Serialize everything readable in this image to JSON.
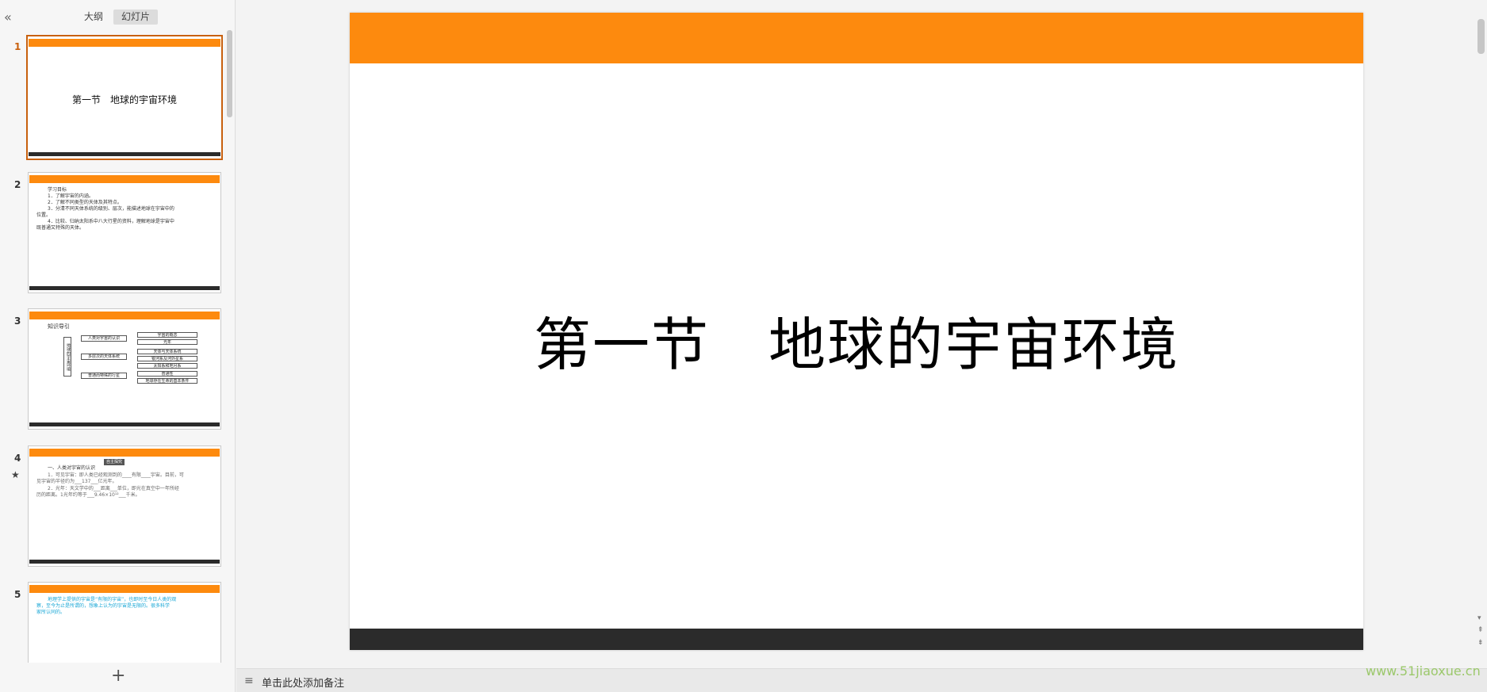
{
  "panel": {
    "collapse_icon": "«",
    "tabs": [
      "大纲",
      "幻灯片"
    ],
    "active_tab": "幻灯片"
  },
  "thumbnails": [
    {
      "num": "1",
      "title": "第一节　地球的宇宙环境"
    },
    {
      "num": "2",
      "lines": [
        "学习目标",
        "1．了解宇宙的内涵。",
        "2．了解不同类型的天体及其特点。",
        "3．分清不同天体系统的级别、层次，能描述地球在宇宙中的",
        "位置。",
        "4．比较、归纳太阳系中八大行星的资料，理解地球是宇宙中",
        "既普通又特殊的天体。"
      ]
    },
    {
      "num": "3",
      "heading": "知识导引",
      "root": "地球的宇宙环境",
      "branches": [
        "人类对宇宙的认识",
        "多层次的天体系统",
        "普通而特殊的行星"
      ],
      "leaves": [
        "宇宙的概念",
        "光年",
        "天体与天体系统",
        "银河系及河外星系",
        "太阳系和地月系",
        "普通性",
        "地球存在生命的基本条件"
      ]
    },
    {
      "num": "4",
      "star": "★",
      "header": "自主探究",
      "lines": [
        "一、人类对宇宙的认识",
        "1．可见宇宙：即人类已经观测到的____有限____宇宙。目前，可",
        "见宇宙的半径约为___137___亿光年。",
        "2．光年：天文学中的___距离___单位，即光在真空中一年所经",
        "历的距离。1光年约等于___9.46×10¹²___千米。"
      ]
    },
    {
      "num": "5",
      "lines": [
        "地理学上提供的宇宙是“有限的宇宙”，也即时至今日人类的观",
        "察，至今为止是所谓的，想象上认为的宇宙是无限的。很多科学",
        "家所认同的。"
      ]
    }
  ],
  "add_slide_icon": "+",
  "slide": {
    "title": "第一节　地球的宇宙环境"
  },
  "notes": {
    "icon": "≡",
    "placeholder": "单击此处添加备注"
  },
  "watermark": "www.51jiaoxue.cn",
  "colors": {
    "accent": "#fd8a0e",
    "dark_bar": "#2b2b2b",
    "selected_border": "#c8600e"
  }
}
